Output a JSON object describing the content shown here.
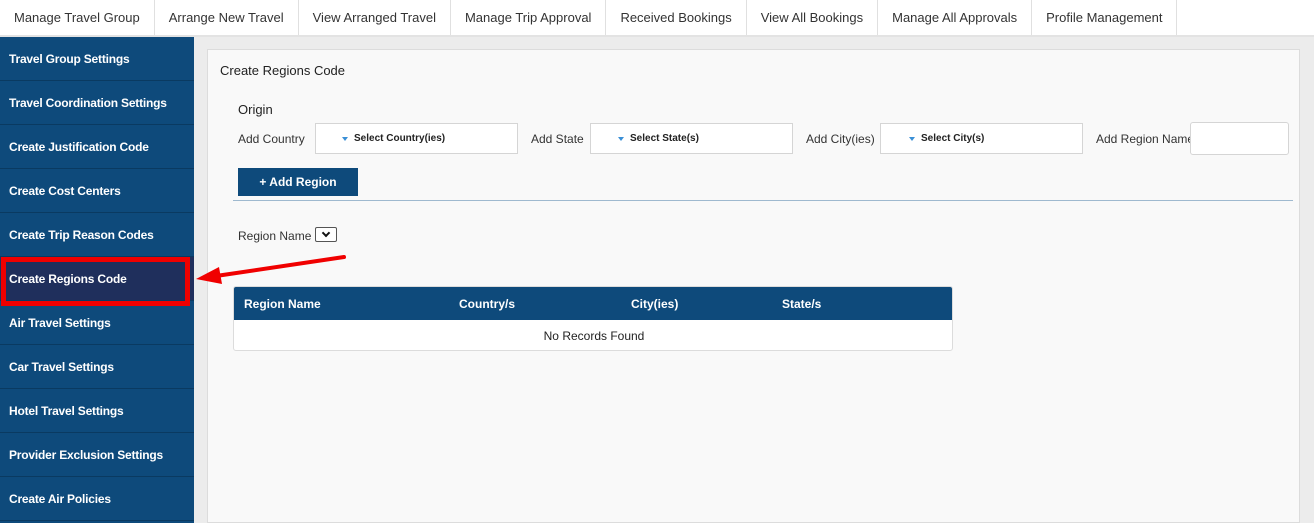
{
  "top_nav": {
    "tabs": [
      {
        "label": "Manage Travel Group"
      },
      {
        "label": "Arrange New Travel"
      },
      {
        "label": "View Arranged Travel"
      },
      {
        "label": "Manage Trip Approval"
      },
      {
        "label": "Received Bookings"
      },
      {
        "label": "View All Bookings"
      },
      {
        "label": "Manage All Approvals"
      },
      {
        "label": "Profile Management"
      }
    ]
  },
  "sidebar": {
    "items": [
      {
        "label": "Travel Group Settings"
      },
      {
        "label": "Travel Coordination Settings"
      },
      {
        "label": "Create Justification Code"
      },
      {
        "label": "Create Cost Centers"
      },
      {
        "label": "Create Trip Reason Codes"
      },
      {
        "label": "Create Regions Code"
      },
      {
        "label": "Air Travel Settings"
      },
      {
        "label": "Car Travel Settings"
      },
      {
        "label": "Hotel Travel Settings"
      },
      {
        "label": "Provider Exclusion Settings"
      },
      {
        "label": "Create Air Policies"
      }
    ],
    "active_item": "Create Regions Code"
  },
  "main": {
    "title": "Create Regions Code",
    "origin_label": "Origin",
    "add_country_label": "Add Country",
    "country_select": "Select Country(ies)",
    "add_state_label": "Add State",
    "state_select": "Select State(s)",
    "add_city_label": "Add City(ies)",
    "city_select": "Select City(s)",
    "add_region_name_label": "Add Region Name",
    "region_name_value": "",
    "add_region_button": "+ Add Region",
    "filter_label": "Region Name",
    "table": {
      "columns": [
        "Region Name",
        "Country/s",
        "City(ies)",
        "State/s"
      ],
      "empty_message": "No Records Found"
    }
  },
  "colors": {
    "nav_blue": "#0e4a7b",
    "active_item": "#1f2f5c",
    "annotation_red": "#f00000",
    "caret_blue": "#3a8fd6"
  }
}
